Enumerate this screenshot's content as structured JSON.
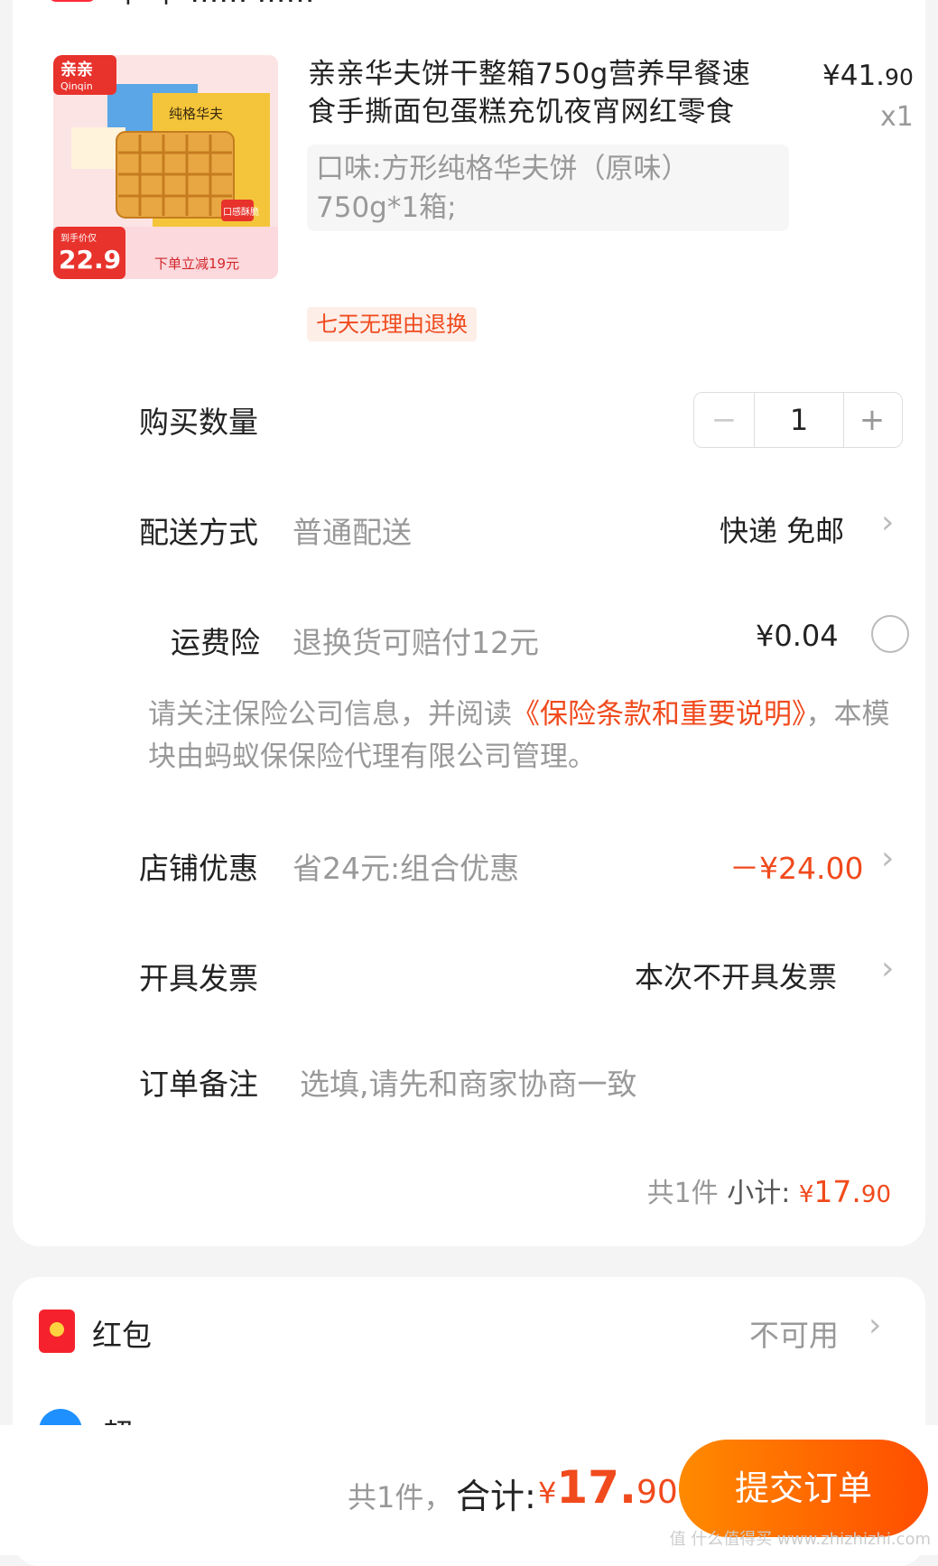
{
  "header": {
    "store_name_fragment": "中 中 …… ……"
  },
  "product": {
    "title": "亲亲华夫饼干整箱750g营养早餐速食手撕面包蛋糕充饥夜宵网红零食",
    "price_currency": "¥",
    "price_main": "41.",
    "price_cents": "90",
    "quantity": "x1",
    "spec": "口味:方形纯格华夫饼（原味）750g*1箱;",
    "return_tag": "七天无理由退换",
    "image": {
      "brand": "亲亲",
      "brand_en": "Qinqin",
      "box_text": "纯格华夫",
      "price_label": "到手价仅",
      "price": "22.9",
      "promo": "下单立减19元",
      "box_tag": "口感酥脆"
    }
  },
  "purchase_qty": {
    "label": "购买数量",
    "value": "1",
    "minus": "−",
    "plus": "+"
  },
  "delivery": {
    "label": "配送方式",
    "method": "普通配送",
    "value": "快递 免邮"
  },
  "shipping_insurance": {
    "label": "运费险",
    "desc": "退换货可赔付12元",
    "price": "¥0.04"
  },
  "notice": {
    "prefix": "请关注保险公司信息，并阅读",
    "link": "《保险条款和重要说明》",
    "suffix": "，本模块由蚂蚁保保险代理有限公司管理。"
  },
  "store_discount": {
    "label": "店铺优惠",
    "desc": "省24元:组合优惠",
    "value": "－¥24.00"
  },
  "invoice": {
    "label": "开具发票",
    "value": "本次不开具发票"
  },
  "remark": {
    "label": "订单备注",
    "placeholder": "选填,请先和商家协商一致"
  },
  "subtotal": {
    "count": "共1件",
    "label": "小计:",
    "currency": "¥",
    "main": "17.",
    "cents": "90"
  },
  "red_packet": {
    "label": "红包",
    "value": "不可用"
  },
  "next_row_fragment": "超… …",
  "bottom_bar": {
    "count": "共1件，",
    "label": "合计:",
    "currency": "¥",
    "main": "17.",
    "cents": "90",
    "submit": "提交订单"
  },
  "watermark": "值 什么值得买 www.zhizhizhi.com",
  "colors": {
    "accent": "#f04a1d",
    "button_start": "#ff8a00",
    "button_end": "#ff4d00"
  },
  "icons": {
    "chevron": "chevron-right-icon",
    "red_packet": "red-packet-icon"
  }
}
